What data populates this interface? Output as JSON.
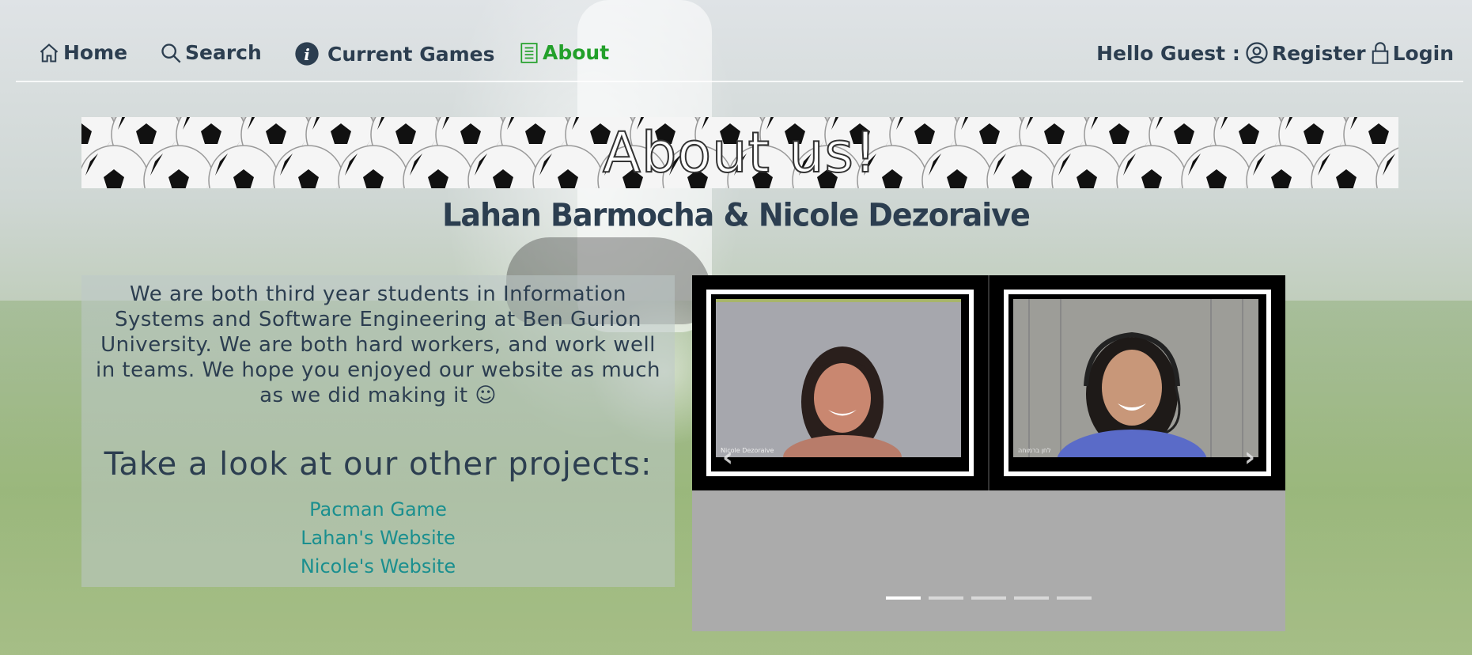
{
  "nav": {
    "home": "Home",
    "search": "Search",
    "current_games": "Current Games",
    "about": "About",
    "greeting": "Hello Guest :",
    "register": "Register",
    "login": "Login"
  },
  "banner": {
    "title": "About us!"
  },
  "authors": "Lahan Barmocha & Nicole Dezoraive",
  "about": {
    "paragraph": "We are both third year students in Information Systems and Software Engineering at Ben Gurion University. We are both hard workers, and work well in teams. We hope you enjoyed our website as much as we did making it ☺",
    "projects_heading": "Take a look at our other projects:",
    "links": [
      "Pacman Game",
      "Lahan's Website",
      "Nicole's Website"
    ]
  },
  "carousel": {
    "captions": [
      "Nicole Dezoraive",
      "לחן ברמוחה"
    ],
    "prev_icon": "chevron-left-icon",
    "next_icon": "chevron-right-icon",
    "indicator_count": 5,
    "active_index": 0
  },
  "colors": {
    "nav_text": "#2c3e50",
    "active": "#22a02a",
    "link": "#1a8f8f"
  }
}
